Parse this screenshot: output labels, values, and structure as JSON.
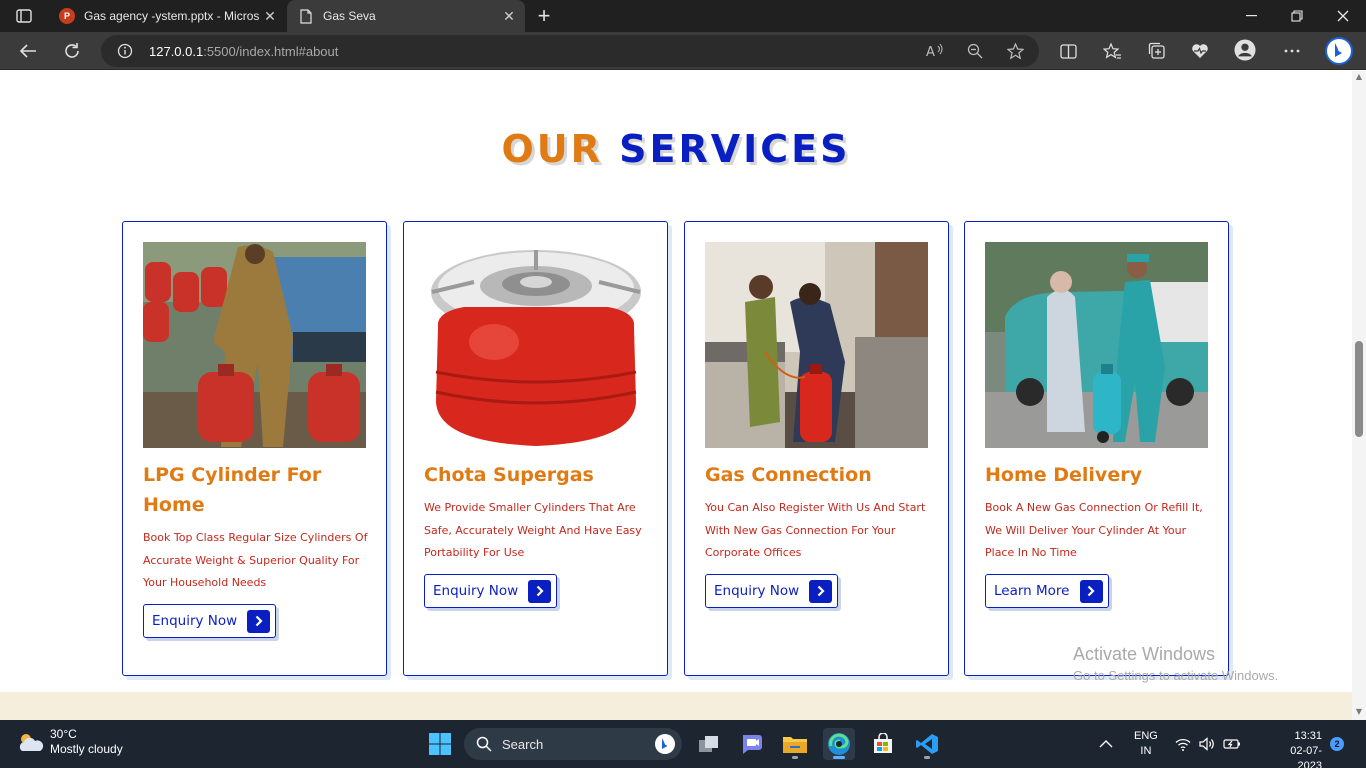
{
  "browser": {
    "tabs": [
      {
        "title": "Gas agency -ystem.pptx - Micros",
        "icon": "powerpoint-icon",
        "active": false
      },
      {
        "title": "Gas Seva",
        "icon": "page-icon",
        "active": true
      }
    ],
    "ppt_letter": "P",
    "new_tab_glyph": "+",
    "url_host": "127.0.0.1",
    "url_path": ":5500/index.html#about",
    "toolbar_icons": [
      "read-aloud-icon",
      "zoom-out-icon",
      "favorite-star-icon",
      "split-screen-icon",
      "favorites-icon",
      "collections-icon",
      "performance-icon",
      "profile-icon",
      "more-icon",
      "bing-icon"
    ]
  },
  "page": {
    "title_part1": "OUR",
    "title_part2": "SERVICES",
    "accent_orange": "#e07b14",
    "accent_blue": "#0a1fc2",
    "text_red": "#c4281c",
    "cards": [
      {
        "title": "LPG Cylinder For Home",
        "description": "Book Top Class Regular Size Cylinders Of Accurate Weight & Superior Quality For Your Household Needs",
        "button": "Enquiry Now",
        "image": "delivery-man-with-cylinders-photo"
      },
      {
        "title": "Chota Supergas",
        "description": "We Provide Smaller Cylinders That Are Safe, Accurately Weight And Have Easy Portability For Use",
        "button": "Enquiry Now",
        "image": "small-red-cylinder-stove-photo"
      },
      {
        "title": "Gas Connection",
        "description": "You Can Also Register With Us And Start With New Gas Connection For Your Corporate Offices",
        "button": "Enquiry Now",
        "image": "technician-connecting-cylinder-photo"
      },
      {
        "title": "Home Delivery",
        "description": "Book A New Gas Connection Or Refill It, We Will Deliver Your Cylinder At Your Place In No Time",
        "button": "Learn More",
        "image": "doorstep-delivery-photo"
      }
    ],
    "watermark_line1": "Activate Windows",
    "watermark_line2": "Go to Settings to activate Windows."
  },
  "taskbar": {
    "temperature": "30°C",
    "weather": "Mostly cloudy",
    "search_label": "Search",
    "language": "ENG",
    "region": "IN",
    "time": "13:31",
    "date": "02-07-2023",
    "notifications": "2",
    "apps": [
      "start-icon",
      "search",
      "task-view-icon",
      "teams-icon",
      "file-explorer-icon",
      "edge-icon",
      "store-icon",
      "vscode-icon"
    ]
  }
}
